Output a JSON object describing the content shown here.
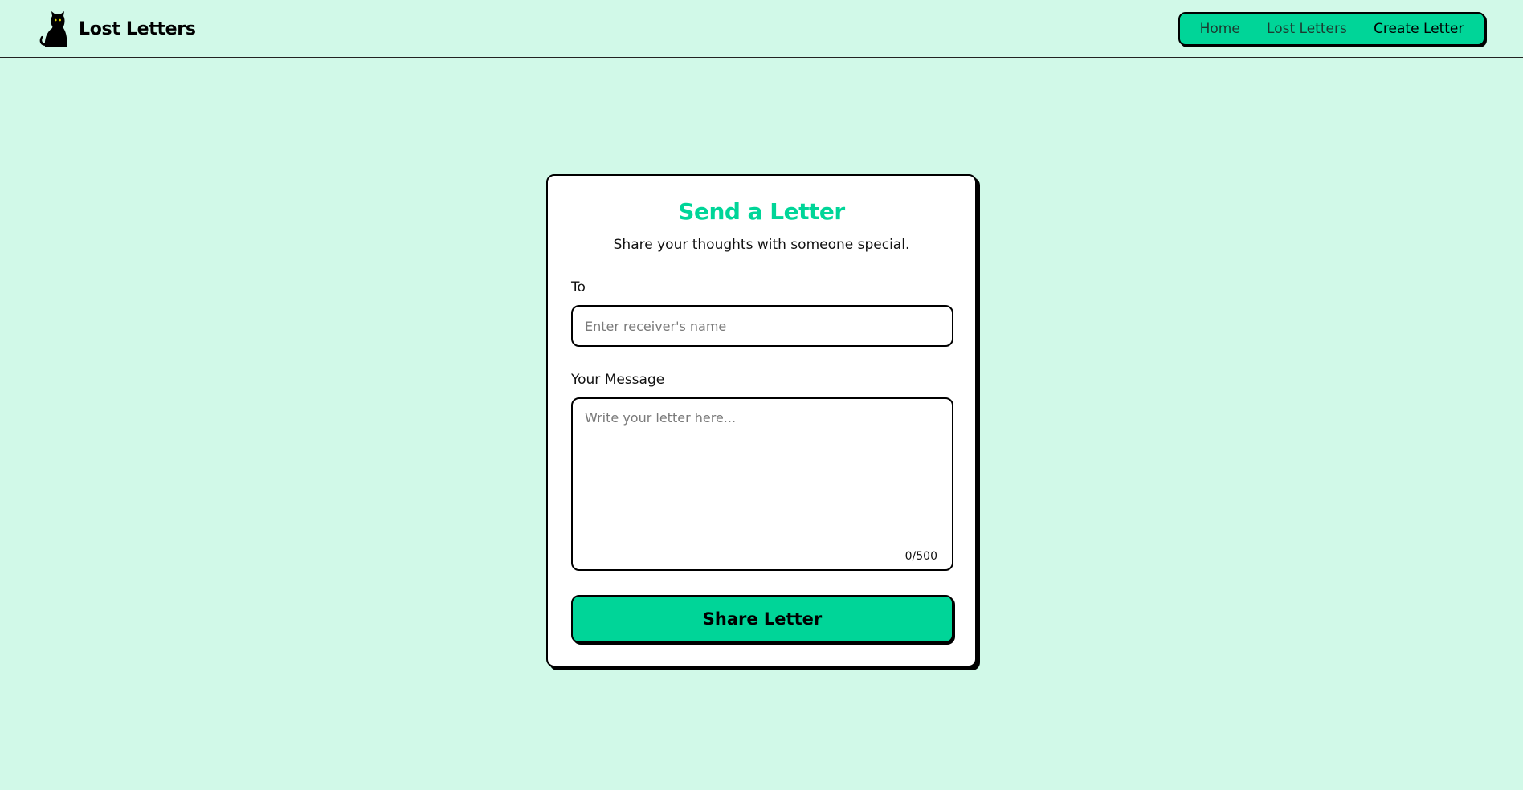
{
  "header": {
    "brand_icon": "cat-icon",
    "brand_name": "Lost Letters",
    "nav": [
      {
        "label": "Home",
        "active": false
      },
      {
        "label": "Lost Letters",
        "active": false
      },
      {
        "label": "Create Letter",
        "active": true
      }
    ]
  },
  "form": {
    "title": "Send a Letter",
    "subtitle": "Share your thoughts with someone special.",
    "to_label": "To",
    "to_value": "",
    "to_placeholder": "Enter receiver's name",
    "message_label": "Your Message",
    "message_value": "",
    "message_placeholder": "Write your letter here...",
    "char_count": "0/500",
    "submit_label": "Share Letter"
  },
  "colors": {
    "background": "#d1f9e8",
    "accent": "#00d598",
    "card": "#ffffff",
    "border": "#000000"
  }
}
